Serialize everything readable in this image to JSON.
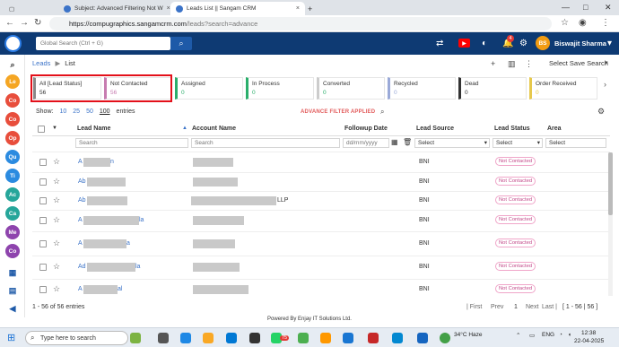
{
  "browser": {
    "tabs": [
      {
        "title": "Subject: Advanced Filtering Not W"
      },
      {
        "title": "Leads List || Sangam CRM"
      }
    ],
    "url_host": "https://compugraphics.sangamcrm.com",
    "url_path": "/leads?search=advance"
  },
  "header": {
    "search_placeholder": "Global Search (Ctrl + G)",
    "notification_count": "4",
    "user_initials": "BS",
    "user_name": "Biswajit Sharma"
  },
  "rail": {
    "items": [
      {
        "icon": "search-icon",
        "text": "🔍"
      },
      {
        "label": "Le",
        "color": "#f5a623"
      },
      {
        "label": "Co",
        "color": "#e84e3c"
      },
      {
        "label": "Co",
        "color": "#e84e3c"
      },
      {
        "label": "Op",
        "color": "#e84e3c"
      },
      {
        "label": "Qu",
        "color": "#2b8be0"
      },
      {
        "label": "Ti",
        "color": "#2b8be0"
      },
      {
        "label": "Ac",
        "color": "#26a69a"
      },
      {
        "label": "Ca",
        "color": "#26a69a"
      },
      {
        "label": "Me",
        "color": "#8e44ad"
      },
      {
        "label": "Co",
        "color": "#8e44ad"
      }
    ]
  },
  "breadcrumb": {
    "root": "Leads",
    "sep": "▶",
    "current": "List"
  },
  "toolbar": {
    "saved_search": "Select Save Search"
  },
  "status_cards": [
    {
      "label": "All [Lead Status]",
      "count": "56",
      "color": "#888888",
      "count_color": "#333333"
    },
    {
      "label": "Not Contacted",
      "count": "56",
      "color": "#c77cb0",
      "count_color": "#c77cb0"
    },
    {
      "label": "Assigned",
      "count": "0",
      "color": "#2aae6b",
      "count_color": "#2aae6b"
    },
    {
      "label": "In Process",
      "count": "0",
      "color": "#2aae6b",
      "count_color": "#2aae6b"
    },
    {
      "label": "Converted",
      "count": "0",
      "color": "#cccccc",
      "count_color": "#2aae6b"
    },
    {
      "label": "Recycled",
      "count": "0",
      "color": "#9aa9d8",
      "count_color": "#9aa9d8"
    },
    {
      "label": "Dead",
      "count": "0",
      "color": "#333333",
      "count_color": "#333333"
    },
    {
      "label": "Order Received",
      "count": "0",
      "color": "#e6c84b",
      "count_color": "#e6c84b"
    }
  ],
  "show": {
    "label": "Show:",
    "options": [
      "10",
      "25",
      "50",
      "100"
    ],
    "selected": "100",
    "suffix": "entries"
  },
  "advanced_filter": "ADVANCE FILTER APPLIED",
  "table": {
    "columns": [
      "Lead Name",
      "Account Name",
      "Followup Date",
      "Lead Source",
      "Lead Status",
      "Area"
    ],
    "filters": {
      "lead_name": "Search",
      "account_name": "Search",
      "followup": "dd/mm/yyyy",
      "source": "Select",
      "status": "Select",
      "area": "Select"
    },
    "rows": [
      {
        "name_visible": "A",
        "name_tail": "n",
        "account_tail": "",
        "source": "BNI",
        "status": "Not Contacted"
      },
      {
        "name_visible": "Ab",
        "name_tail": "",
        "account_tail": "",
        "source": "BNI",
        "status": "Not Contacted"
      },
      {
        "name_visible": "Ab",
        "name_tail": "",
        "account_tail": "LLP",
        "source": "BNI",
        "status": "Not Contacted"
      },
      {
        "name_visible": "A",
        "name_tail": "la",
        "account_tail": "",
        "source": "BNI",
        "status": "Not Contacted"
      },
      {
        "name_visible": "A",
        "name_tail": "a",
        "account_tail": "",
        "source": "BNI",
        "status": "Not Contacted"
      },
      {
        "name_visible": "Ad",
        "name_tail": "la",
        "account_tail": "",
        "source": "BNI",
        "status": "Not Contacted"
      },
      {
        "name_visible": "A",
        "name_tail": "al",
        "account_tail": "",
        "source": "BNI",
        "status": "Not Contacted"
      }
    ]
  },
  "pagination": {
    "summary": "1 - 56 of 56 entries",
    "first": "| First",
    "prev": "Prev",
    "page": "1",
    "next": "Next",
    "last": "Last |",
    "range": "[ 1 - 56 | 56 ]"
  },
  "footer": {
    "powered_by": "Powered By Enjay IT Solutions Ltd."
  },
  "taskbar": {
    "search_placeholder": "Type here to search",
    "teams_badge": "75",
    "weather": "34°C  Haze",
    "lang": "ENG",
    "time": "12:38",
    "date": "22-04-2025"
  }
}
